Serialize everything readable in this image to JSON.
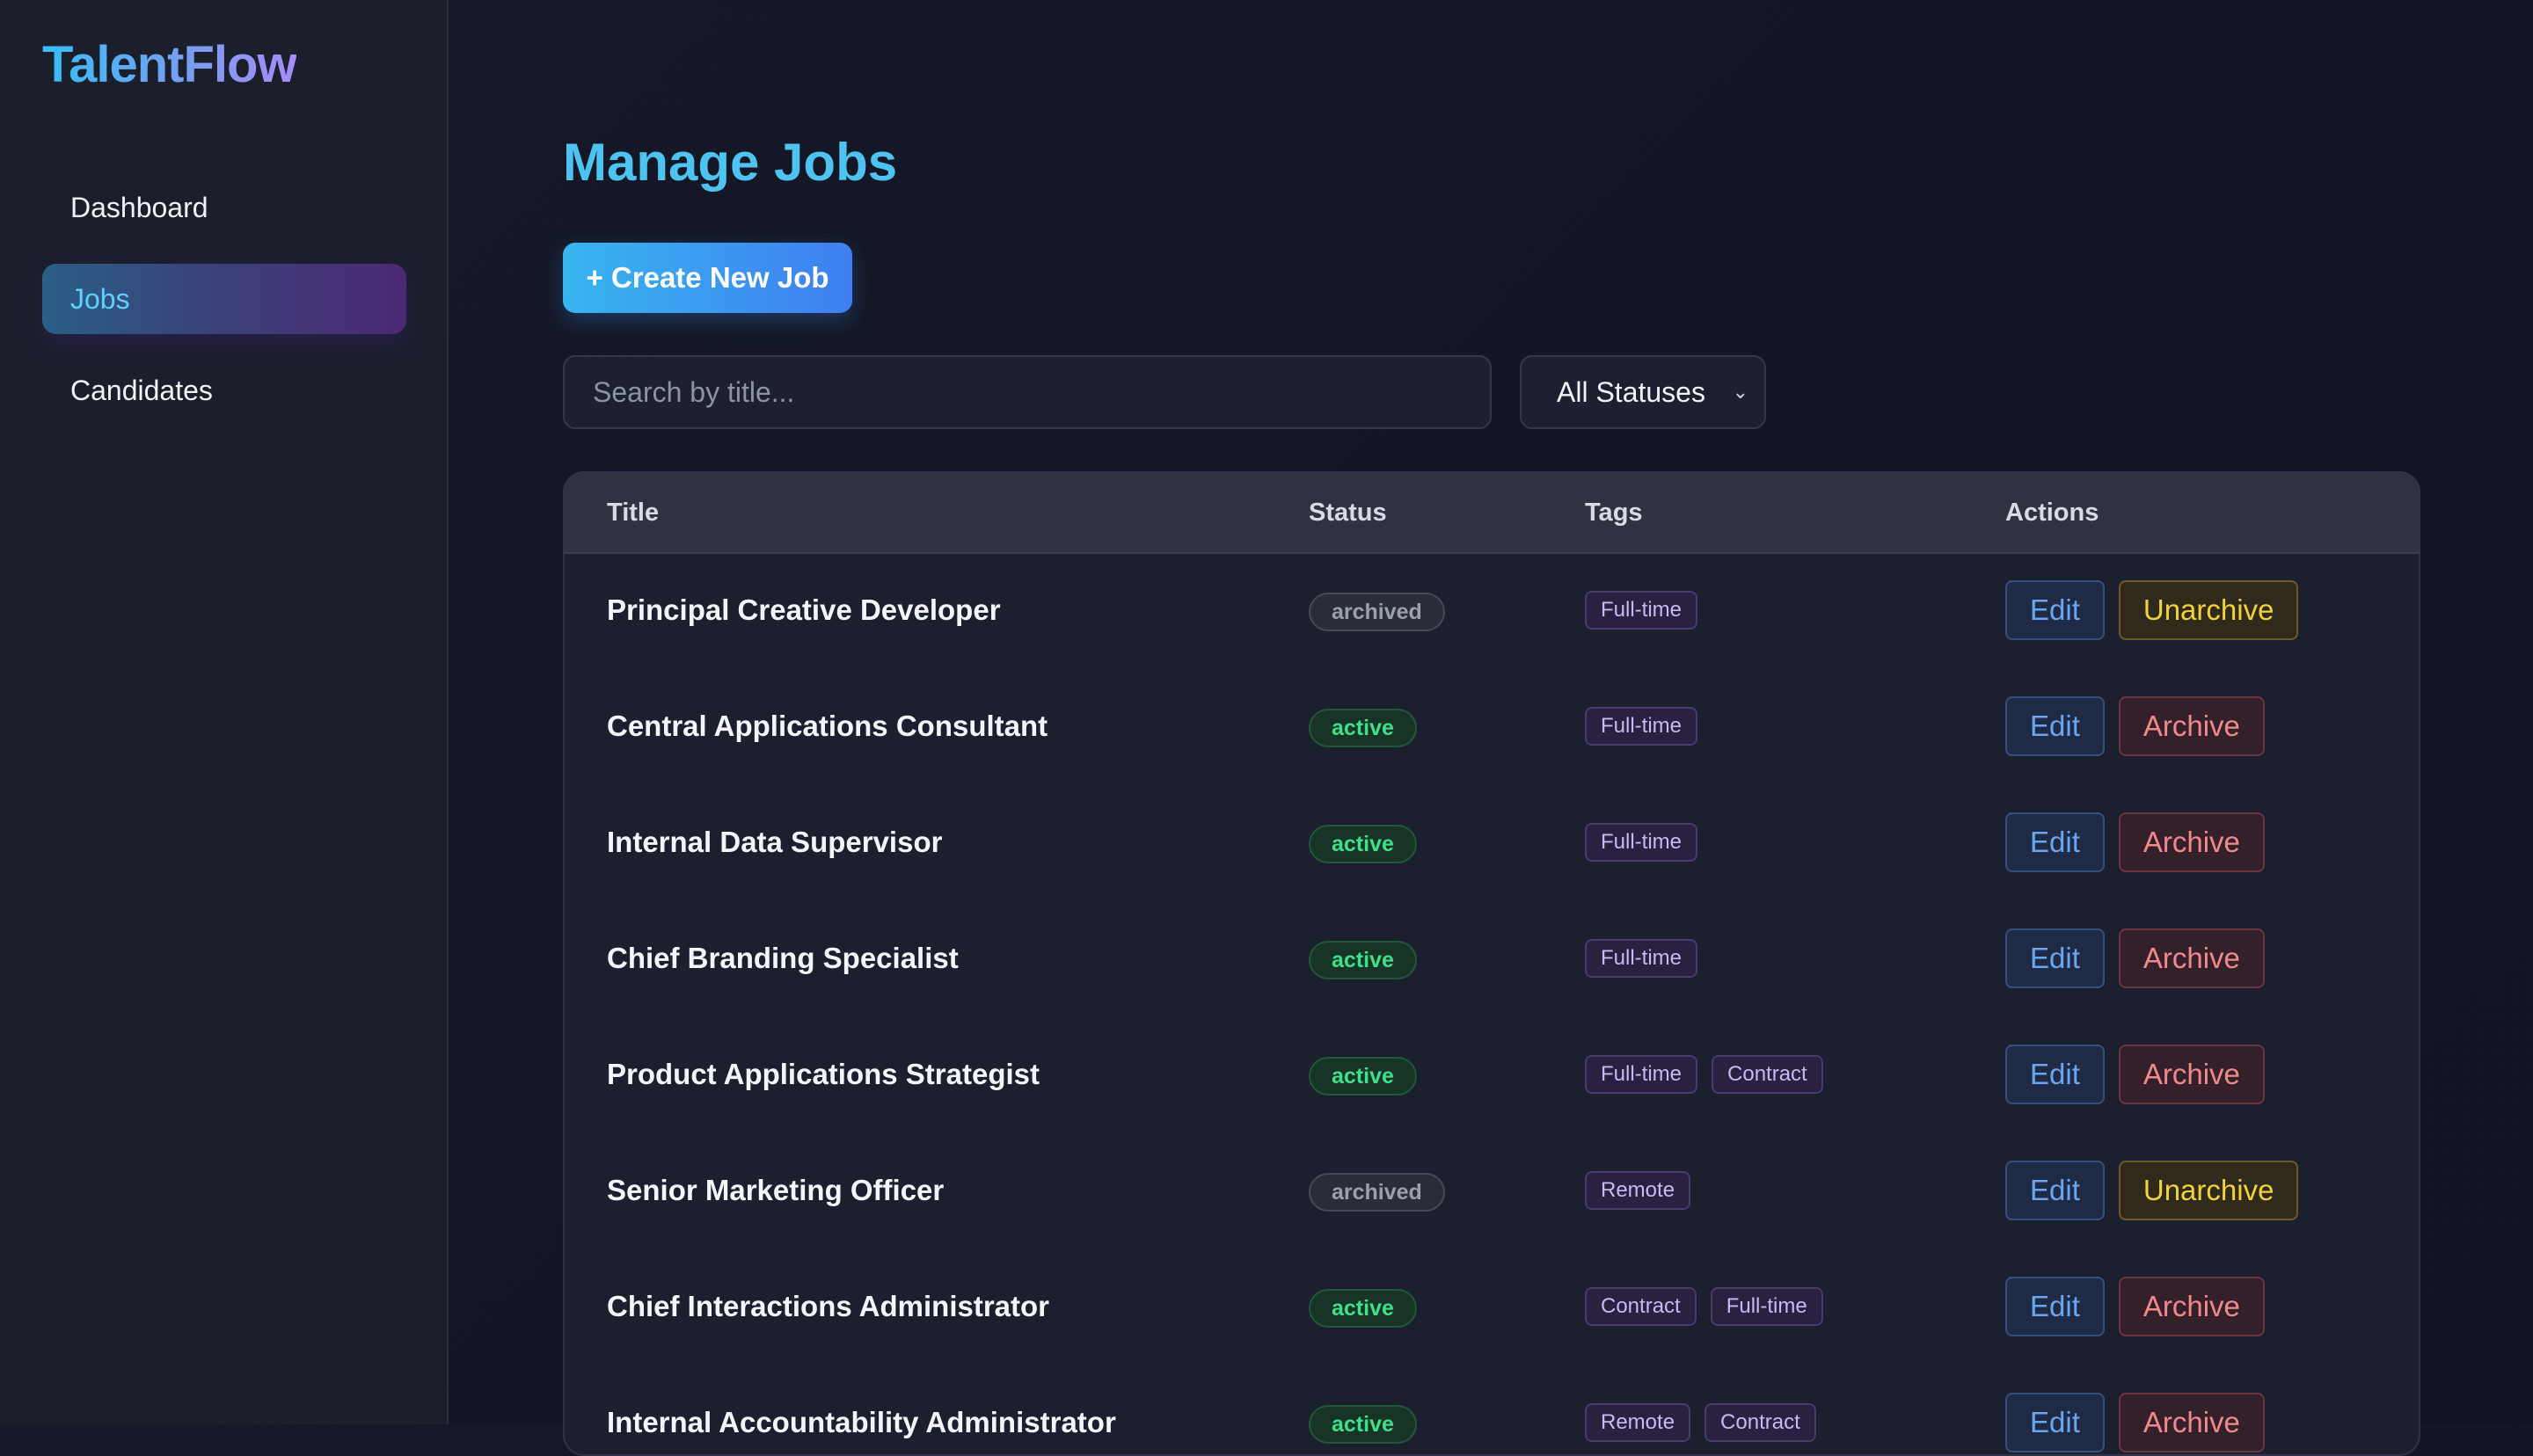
{
  "app": {
    "logo": "TalentFlow"
  },
  "sidebar": {
    "items": [
      {
        "label": "Dashboard",
        "active": false
      },
      {
        "label": "Jobs",
        "active": true
      },
      {
        "label": "Candidates",
        "active": false
      }
    ]
  },
  "main": {
    "title": "Manage Jobs",
    "create_button": "+ Create New Job",
    "search": {
      "placeholder": "Search by title...",
      "value": ""
    },
    "status_filter": {
      "selected": "All Statuses"
    }
  },
  "table": {
    "headers": {
      "title": "Title",
      "status": "Status",
      "tags": "Tags",
      "actions": "Actions"
    },
    "rows": [
      {
        "title": "Principal Creative Developer",
        "status": "archived",
        "tags": [
          "Full-time"
        ],
        "actions": [
          "Edit",
          "Unarchive"
        ]
      },
      {
        "title": "Central Applications Consultant",
        "status": "active",
        "tags": [
          "Full-time"
        ],
        "actions": [
          "Edit",
          "Archive"
        ]
      },
      {
        "title": "Internal Data Supervisor",
        "status": "active",
        "tags": [
          "Full-time"
        ],
        "actions": [
          "Edit",
          "Archive"
        ]
      },
      {
        "title": "Chief Branding Specialist",
        "status": "active",
        "tags": [
          "Full-time"
        ],
        "actions": [
          "Edit",
          "Archive"
        ]
      },
      {
        "title": "Product Applications Strategist",
        "status": "active",
        "tags": [
          "Full-time",
          "Contract"
        ],
        "actions": [
          "Edit",
          "Archive"
        ]
      },
      {
        "title": "Senior Marketing Officer",
        "status": "archived",
        "tags": [
          "Remote"
        ],
        "actions": [
          "Edit",
          "Unarchive"
        ]
      },
      {
        "title": "Chief Interactions Administrator",
        "status": "active",
        "tags": [
          "Contract",
          "Full-time"
        ],
        "actions": [
          "Edit",
          "Archive"
        ]
      },
      {
        "title": "Internal Accountability Administrator",
        "status": "active",
        "tags": [
          "Remote",
          "Contract"
        ],
        "actions": [
          "Edit",
          "Archive"
        ]
      }
    ]
  },
  "colors": {
    "accent": "#4fc3f0",
    "active_status": "#3ee08a",
    "archived_status": "#9aa0ae",
    "archive_action": "#f08a8a",
    "unarchive_action": "#f2d23a",
    "edit_action": "#6aa7f0"
  }
}
